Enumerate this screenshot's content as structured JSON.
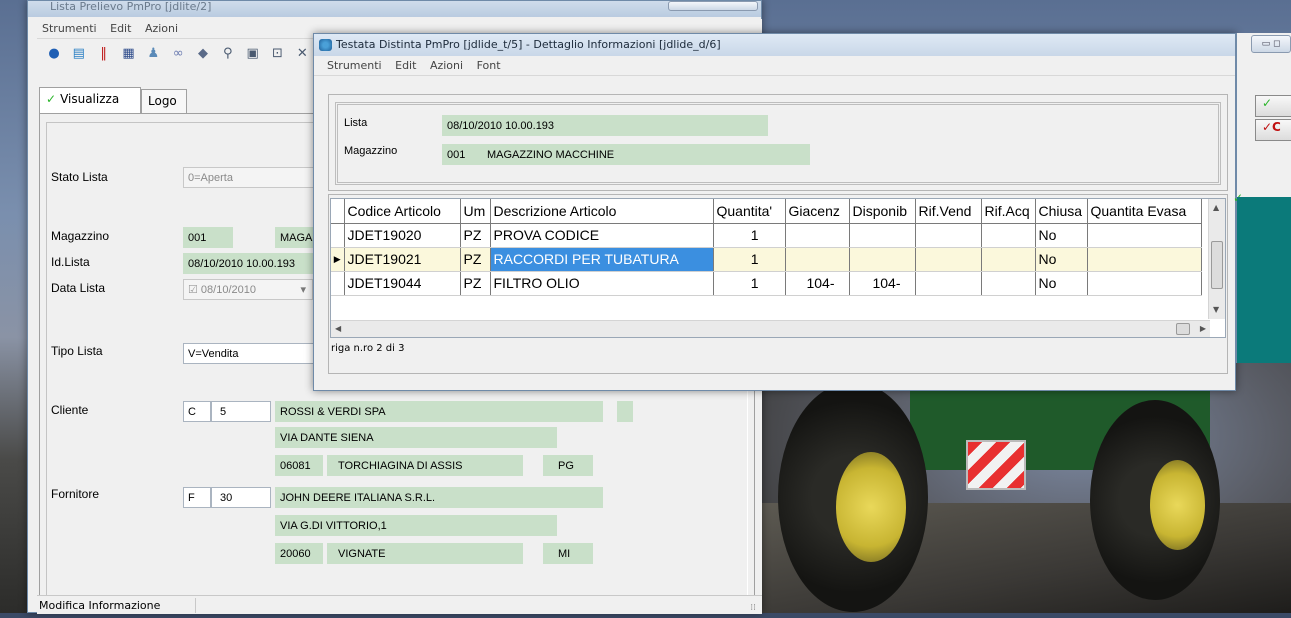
{
  "back_window": {
    "title": "Lista Prelievo PmPro [jdlite/2]",
    "menu": [
      "Strumenti",
      "Edit",
      "Azioni"
    ],
    "tabs": [
      {
        "label": "Visualizza",
        "active": true
      },
      {
        "label": "Logo",
        "active": false
      }
    ],
    "fields": {
      "stato_lista": {
        "label": "Stato Lista",
        "value": "0=Aperta"
      },
      "magazzino": {
        "label": "Magazzino",
        "code": "001",
        "desc": "MAGA"
      },
      "id_lista": {
        "label": "Id.Lista",
        "value": "08/10/2010 10.00.193"
      },
      "data_lista": {
        "label": "Data Lista",
        "value": "08/10/2010"
      },
      "tipo_lista": {
        "label": "Tipo Lista",
        "value": "V=Vendita"
      },
      "cliente": {
        "label": "Cliente",
        "type": "C",
        "code": "5",
        "name": "ROSSI & VERDI SPA",
        "address": "VIA DANTE SIENA",
        "cap": "06081",
        "city": "TORCHIAGINA DI ASSIS",
        "prov": "PG"
      },
      "fornitore": {
        "label": "Fornitore",
        "type": "F",
        "code": "30",
        "name": "JOHN DEERE ITALIANA S.R.L.",
        "address": "VIA G.DI VITTORIO,1",
        "cap": "20060",
        "city": "VIGNATE",
        "prov": "MI"
      }
    },
    "status": "Modifica Informazione"
  },
  "front_window": {
    "title": "Testata Distinta PmPro [jdlide_t/5] - Dettaglio Informazioni [jdlide_d/6]",
    "menu": [
      "Strumenti",
      "Edit",
      "Azioni",
      "Font"
    ],
    "header": {
      "lista_label": "Lista",
      "lista_value": "08/10/2010 10.00.193",
      "magazzino_label": "Magazzino",
      "magazzino_code": "001",
      "magazzino_desc": "MAGAZZINO MACCHINE"
    },
    "grid": {
      "columns": [
        "Codice Articolo",
        "Um",
        "Descrizione Articolo",
        "Quantita'",
        "Giacenz",
        "Disponib",
        "Rif.Vend",
        "Rif.Acq",
        "Chiusa",
        "Quantita Evasa"
      ],
      "rows": [
        {
          "codice": "JDET19020",
          "um": "PZ",
          "desc": "PROVA CODICE",
          "qta": "1",
          "giac": "",
          "disp": "",
          "rifv": "",
          "rifa": "",
          "chiusa": "No",
          "evasa": ""
        },
        {
          "codice": "JDET19021",
          "um": "PZ",
          "desc": "RACCORDI PER TUBATURA",
          "qta": "1",
          "giac": "",
          "disp": "",
          "rifv": "",
          "rifa": "",
          "chiusa": "No",
          "evasa": ""
        },
        {
          "codice": "JDET19044",
          "um": "PZ",
          "desc": "FILTRO OLIO",
          "qta": "1",
          "giac": "104-",
          "disp": "104-",
          "rifv": "",
          "rifa": "",
          "chiusa": "No",
          "evasa": ""
        }
      ],
      "selected_row": 1
    },
    "row_info": "riga n.ro 2 di 3"
  },
  "right_window": {
    "ok_label": "✓",
    "cancel_label": "✓C"
  },
  "colors": {
    "field_green": "#c9e0c9",
    "selection_blue": "#3b8fe0",
    "selected_row": "#fbf8dc",
    "teal": "#0b7a7a"
  }
}
